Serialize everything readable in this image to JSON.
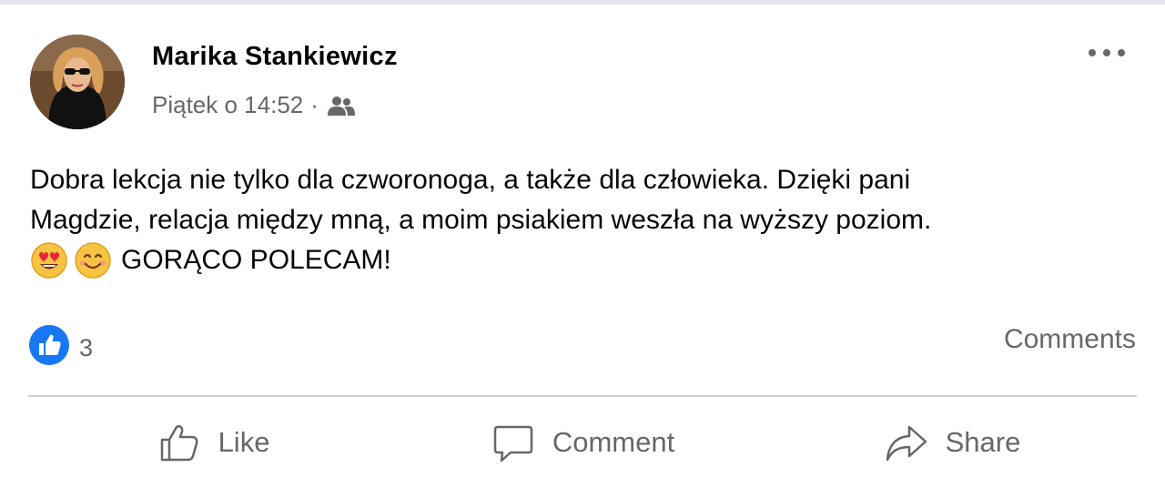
{
  "post": {
    "author": "Marika Stankiewicz",
    "timestamp": "Piątek o 14:52",
    "separator": "·",
    "audience_icon": "friends-icon",
    "text_line_1": "Dobra lekcja nie tylko dla czworonoga, a także dla człowieka. Dzięki pani",
    "text_line_2": "Magdzie, relacja między mną, a moim psiakiem weszła na wyższy poziom.",
    "text_line_3": "GORĄCO POLECAM!",
    "emojis": [
      "heart-eyes-emoji",
      "smiling-face-emoji"
    ]
  },
  "reactions": {
    "icon": "like-reaction-icon",
    "count": "3",
    "comments_label": "Comments"
  },
  "actions": {
    "like_label": "Like",
    "comment_label": "Comment",
    "share_label": "Share"
  },
  "colors": {
    "primary_text": "#050505",
    "secondary_text": "#65676b",
    "like_blue": "#1877f2",
    "divider": "#ced0d4"
  }
}
